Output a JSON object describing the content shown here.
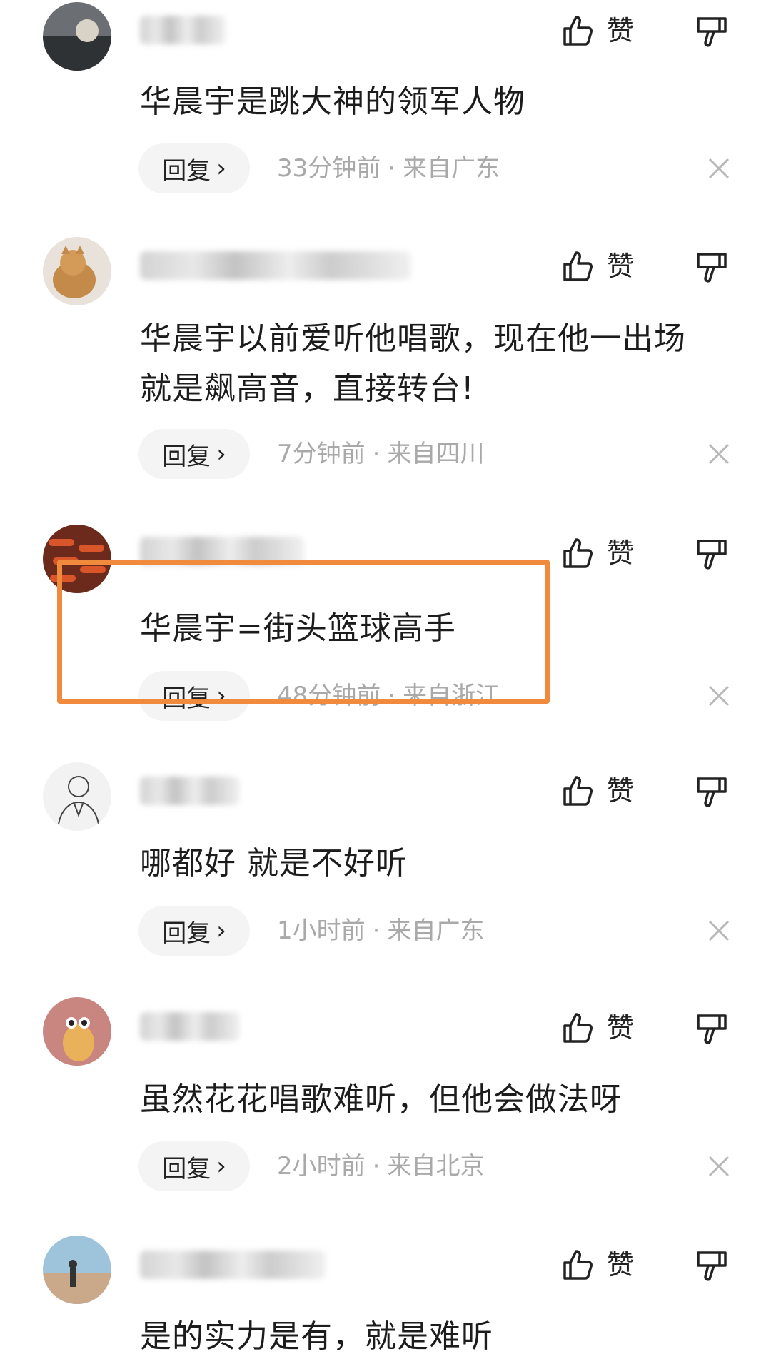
{
  "like_label": "赞",
  "reply_label": "回复",
  "comments": [
    {
      "text_lines": [
        "华晨宇是跳大神的领军人物"
      ],
      "time": "33分钟前",
      "location": "来自广东"
    },
    {
      "text_lines": [
        "华晨宇以前爱听他唱歌，现在他一出场",
        "就是飙高音，直接转台!"
      ],
      "time": "7分钟前",
      "location": "来自四川"
    },
    {
      "text_lines": [
        "华晨宇=街头篮球高手"
      ],
      "time": "48分钟前",
      "location": "来自浙江"
    },
    {
      "text_lines": [
        "哪都好 就是不好听"
      ],
      "time": "1小时前",
      "location": "来自广东"
    },
    {
      "text_lines": [
        "虽然花花唱歌难听，但他会做法呀"
      ],
      "time": "2小时前",
      "location": "来自北京"
    },
    {
      "text_lines": [
        "是的实力是有，就是难听"
      ]
    }
  ],
  "colors": {
    "highlight": "#f08a3c",
    "meta_text": "#a9a9a9",
    "pill_bg": "#f4f4f4"
  }
}
